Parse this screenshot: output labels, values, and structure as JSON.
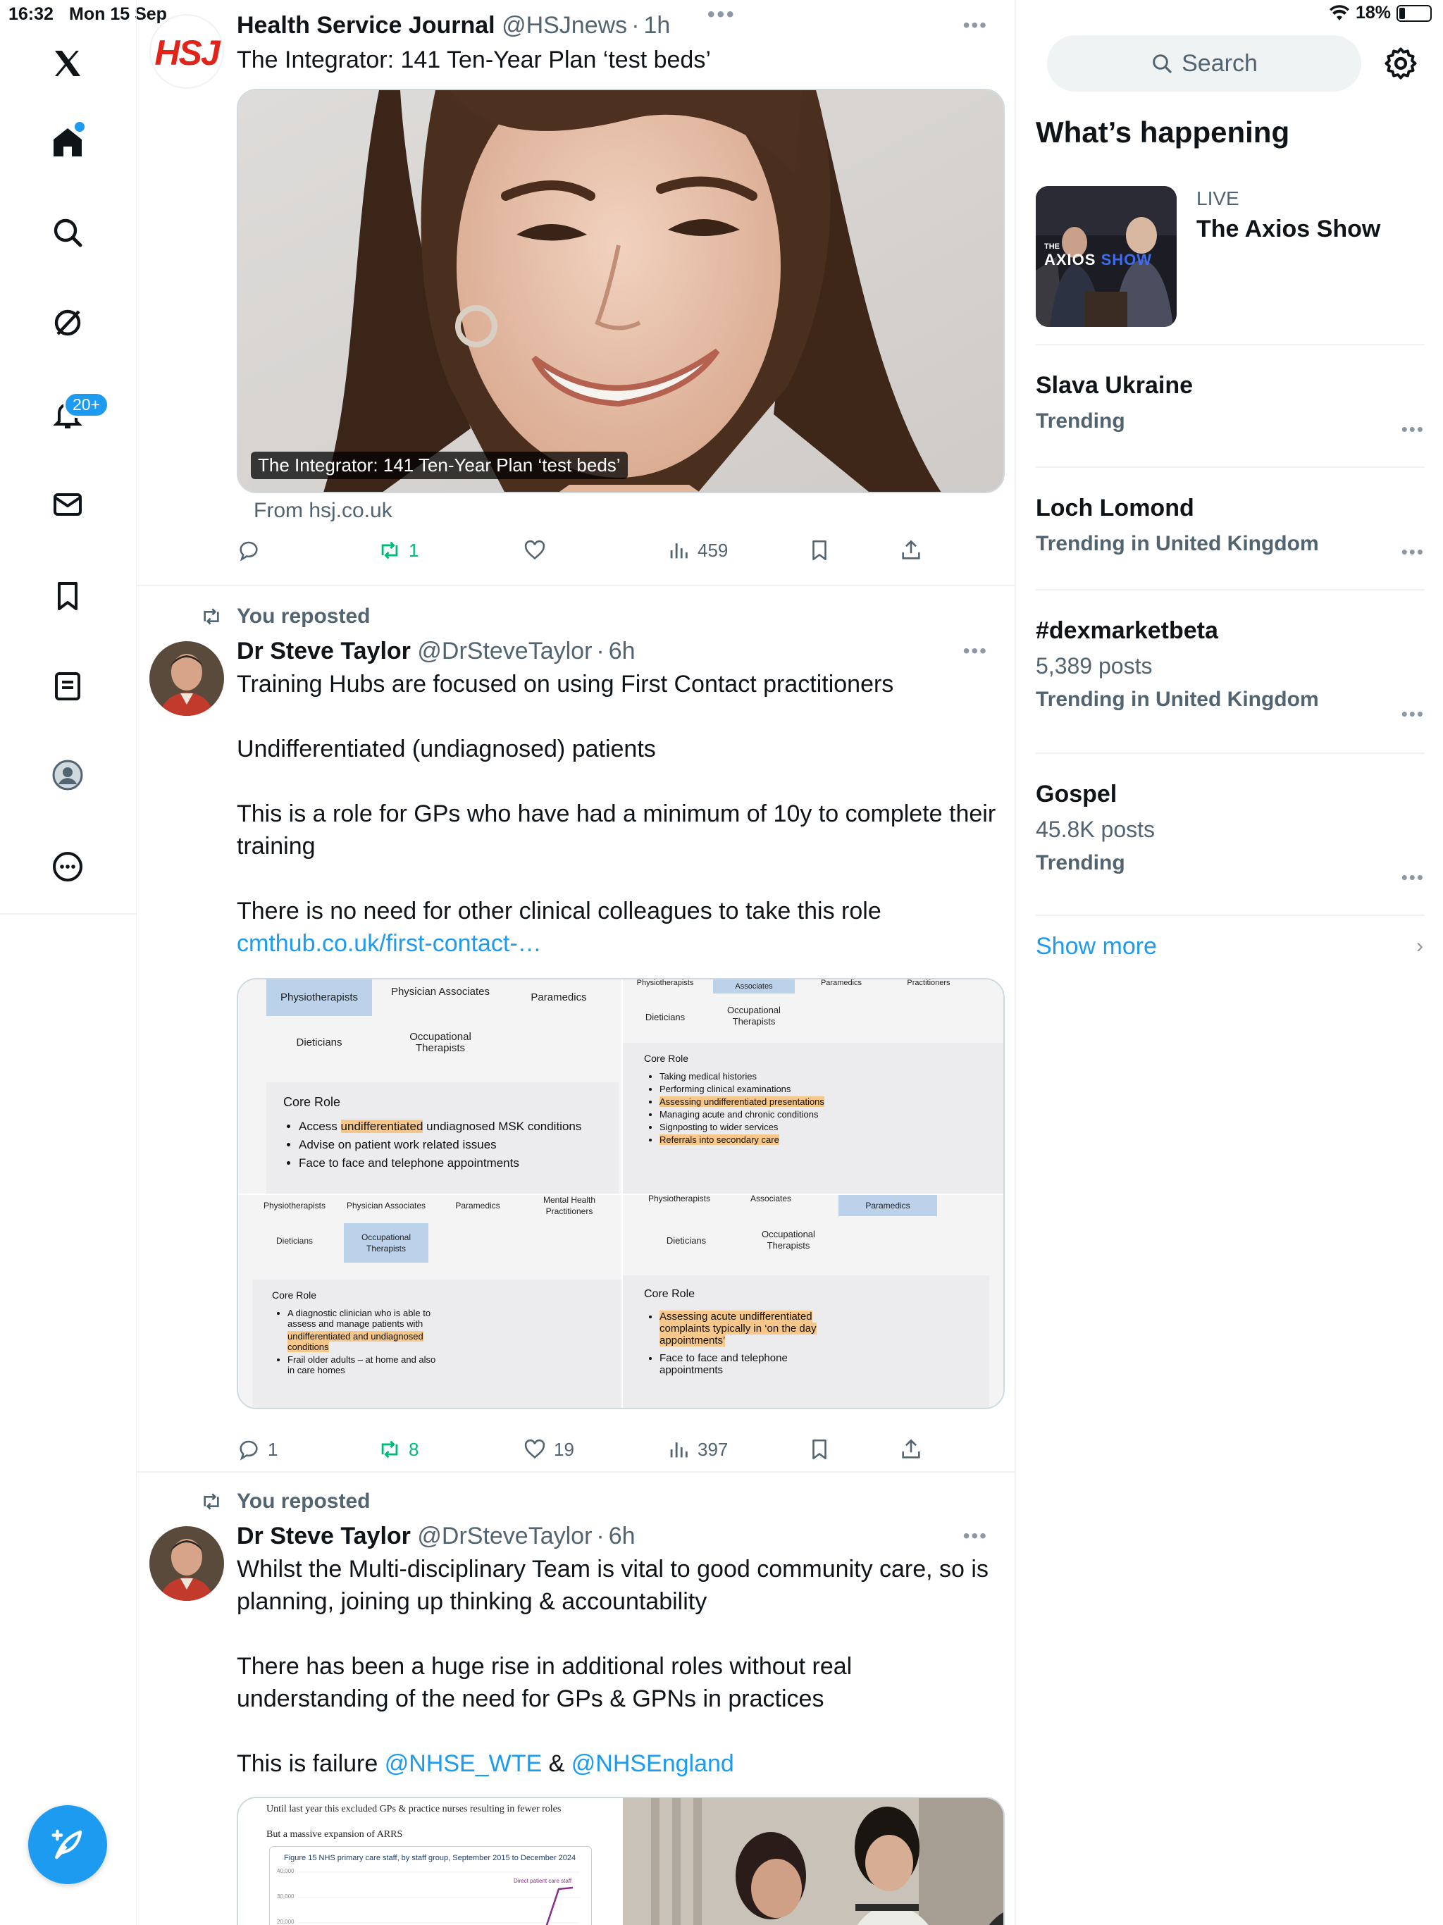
{
  "status_bar": {
    "time": "16:32",
    "date": "Mon 15 Sep",
    "battery": "18%",
    "battery_level": 0.18
  },
  "nav": {
    "notifications_badge": "20+",
    "compose_label": "Post"
  },
  "posts": [
    {
      "name": "Health Service Journal",
      "handle": "@HSJnews",
      "time": "1h",
      "text": "The Integrator: 141 Ten-Year Plan ‘test beds’",
      "avatar_text": "HSJ",
      "card_caption": "The Integrator: 141 Ten-Year Plan ‘test beds’",
      "card_source": "From hsj.co.uk",
      "replies": "",
      "reposts": "1",
      "likes": "",
      "views": "459"
    },
    {
      "repost_label": "You reposted",
      "name": "Dr Steve Taylor",
      "handle": "@DrSteveTaylor",
      "time": "6h",
      "paragraphs": [
        "Training Hubs are focused on using First Contact practitioners",
        "Undifferentiated (undiagnosed) patients",
        "This is a role for GPs who have had a minimum of 10y to complete their training",
        "There is no need for other clinical colleagues to take this role"
      ],
      "link": "cmthub.co.uk/first-contact-…",
      "replies": "1",
      "reposts": "8",
      "likes": "19",
      "views": "397",
      "media": {
        "q1": {
          "chips": [
            "Physiotherapists",
            "Physician Associates",
            "Paramedics",
            "Dieticians",
            "Occupational Therapists"
          ],
          "core_title": "Core Role",
          "items": [
            "Access undifferentiated undiagnosed MSK conditions",
            "Advise on patient work related issues",
            "Face to face and telephone appointments"
          ],
          "highlight": "undifferentiated"
        },
        "q2": {
          "chips": [
            "Physiotherapists",
            "Associates",
            "Paramedics",
            "Practitioners",
            "Dieticians",
            "Occupational Therapists"
          ],
          "core_title": "Core Role",
          "items": [
            "Taking medical histories",
            "Performing clinical examinations",
            "Assessing undifferentiated presentations",
            "Managing acute and chronic conditions",
            "Signposting to wider services",
            "Referrals into secondary care"
          ]
        },
        "q3": {
          "chips": [
            "Physiotherapists",
            "Physician Associates",
            "Paramedics",
            "Mental Health Practitioners",
            "Dieticians",
            "Occupational Therapists"
          ],
          "core_title": "Core Role",
          "items": [
            "A diagnostic clinician who is able to assess and manage patients with",
            "undifferentiated and undiagnosed conditions",
            "Frail older adults – at home and also in care homes"
          ]
        },
        "q4": {
          "chips": [
            "Physiotherapists",
            "Associates",
            "Paramedics",
            "Dieticians",
            "Occupational Therapists"
          ],
          "core_title": "Core Role",
          "items": [
            "Assessing acute undifferentiated complaints typically in ‘on the day appointments’",
            "Face to face and telephone appointments"
          ]
        }
      }
    },
    {
      "repost_label": "You reposted",
      "name": "Dr Steve Taylor",
      "handle": "@DrSteveTaylor",
      "time": "6h",
      "line1": "Whilst the Multi-disciplinary Team is vital to good community care, so is planning, joining up thinking & accountability",
      "line2": "There has been a huge rise in additional roles without real understanding of the need for GPs & GPNs in practices",
      "line3_prefix": "This is failure ",
      "mention1": "@NHSE_WTE",
      "amp": " & ",
      "mention2": "@NHSEngland",
      "doc": {
        "line_a": "Until last year this excluded GPs & practice nurses resulting in fewer roles",
        "line_b": "But a massive expansion of ARRS",
        "fig_title": "Figure 15 NHS primary care staff, by staff group, September 2015 to December 2024",
        "series_label": "Direct patient care staff",
        "y_ticks": [
          "40,000",
          "30,000",
          "20,000"
        ]
      }
    }
  ],
  "sidebar": {
    "search_placeholder": "Search",
    "whats_happening": "What’s happening",
    "live_label": "LIVE",
    "live_title": "The Axios Show",
    "live_thumb_brand_small": "THE",
    "live_thumb_brand": "AXIOS",
    "live_thumb_brand_accent": "SHOW",
    "trends": [
      {
        "name": "Slava Ukraine",
        "sub": "Trending"
      },
      {
        "name": "Loch Lomond",
        "sub": "Trending in United Kingdom"
      },
      {
        "name": "#dexmarketbeta",
        "count": "5,389 posts",
        "sub": "Trending in United Kingdom"
      },
      {
        "name": "Gospel",
        "count": "45.8K posts",
        "sub": "Trending"
      }
    ],
    "show_more": "Show more"
  },
  "colors": {
    "accent": "#1d9bf0",
    "repost_green": "#00ba7c",
    "muted": "#536471"
  }
}
